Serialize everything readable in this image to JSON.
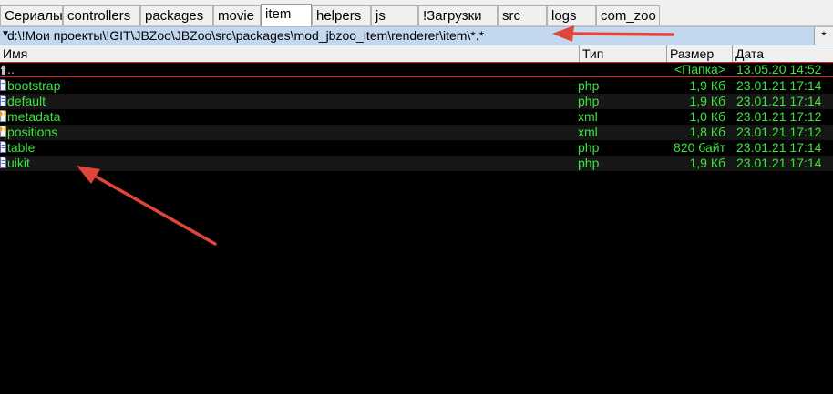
{
  "tabs": [
    {
      "label": "Сериалы",
      "active": false
    },
    {
      "label": "controllers",
      "active": false
    },
    {
      "label": "packages",
      "active": false
    },
    {
      "label": "movie",
      "active": false
    },
    {
      "label": "item",
      "active": true
    },
    {
      "label": "helpers",
      "active": false
    },
    {
      "label": "js",
      "active": false
    },
    {
      "label": "!Загрузки",
      "active": false
    },
    {
      "label": "src",
      "active": false
    },
    {
      "label": "logs",
      "active": false
    },
    {
      "label": "com_zoo",
      "active": false
    }
  ],
  "path": {
    "text": "d:\\!Мои проекты\\!GIT\\JBZoo\\JBZoo\\src\\packages\\mod_jbzoo_item\\renderer\\item\\*.*",
    "star": "*"
  },
  "columns": {
    "name": "Имя",
    "type": "Тип",
    "size": "Размер",
    "date": "Дата"
  },
  "parent_row": {
    "name": "..",
    "size": "<Папка>",
    "date": "13.05.20 14:52"
  },
  "files": [
    {
      "name": "bootstrap",
      "type": "php",
      "size": "1,9 Кб",
      "date": "23.01.21 17:14",
      "icon": "php-file-icon"
    },
    {
      "name": "default",
      "type": "php",
      "size": "1,9 Кб",
      "date": "23.01.21 17:14",
      "icon": "php-file-icon"
    },
    {
      "name": "metadata",
      "type": "xml",
      "size": "1,0 Кб",
      "date": "23.01.21 17:12",
      "icon": "xml-file-icon"
    },
    {
      "name": "positions",
      "type": "xml",
      "size": "1,8 Кб",
      "date": "23.01.21 17:12",
      "icon": "xml-file-icon"
    },
    {
      "name": "table",
      "type": "php",
      "size": "820 байт",
      "date": "23.01.21 17:14",
      "icon": "php-file-icon"
    },
    {
      "name": "uikit",
      "type": "php",
      "size": "1,9 Кб",
      "date": "23.01.21 17:14",
      "icon": "php-file-icon"
    }
  ],
  "colors": {
    "file_text": "#3fe23f",
    "background": "#000000",
    "path_bar": "#c3d8ee",
    "annotation": "#e0453a"
  }
}
